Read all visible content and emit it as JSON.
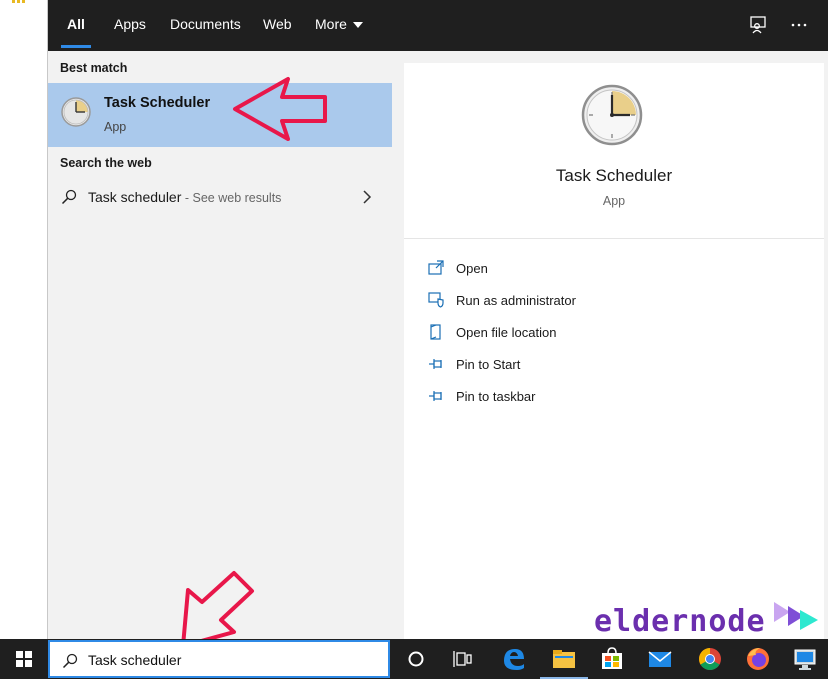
{
  "tabs": [
    {
      "label": "All"
    },
    {
      "label": "Apps"
    },
    {
      "label": "Documents"
    },
    {
      "label": "Web"
    },
    {
      "label": "More"
    }
  ],
  "top_icons": [
    "feedback-icon",
    "more-options-icon"
  ],
  "left": {
    "best_match_label": "Best match",
    "best_match": {
      "name": "Task Scheduler",
      "type": "App",
      "icon": "task-scheduler-clock-icon"
    },
    "search_web_label": "Search the web",
    "web_result": {
      "query": "Task scheduler",
      "hint": " - See web results"
    }
  },
  "preview": {
    "name": "Task Scheduler",
    "type": "App",
    "actions": [
      {
        "label": "Open",
        "icon": "open-icon"
      },
      {
        "label": "Run as administrator",
        "icon": "shield-icon"
      },
      {
        "label": "Open file location",
        "icon": "file-location-icon"
      },
      {
        "label": "Pin to Start",
        "icon": "pin-icon"
      },
      {
        "label": "Pin to taskbar",
        "icon": "pin-icon"
      }
    ]
  },
  "taskbar": {
    "search_value": "Task scheduler",
    "apps": [
      "cortana-icon",
      "task-view-icon",
      "edge-icon",
      "file-explorer-icon",
      "store-icon",
      "mail-icon",
      "chrome-icon",
      "firefox-icon",
      "remote-desktop-icon"
    ]
  },
  "logo": {
    "text": "eldernode"
  },
  "colors": {
    "accent": "#2f8ae6",
    "highlight": "#aac9ec",
    "annotation": "#e8174a",
    "dark": "#1f1f1f"
  }
}
